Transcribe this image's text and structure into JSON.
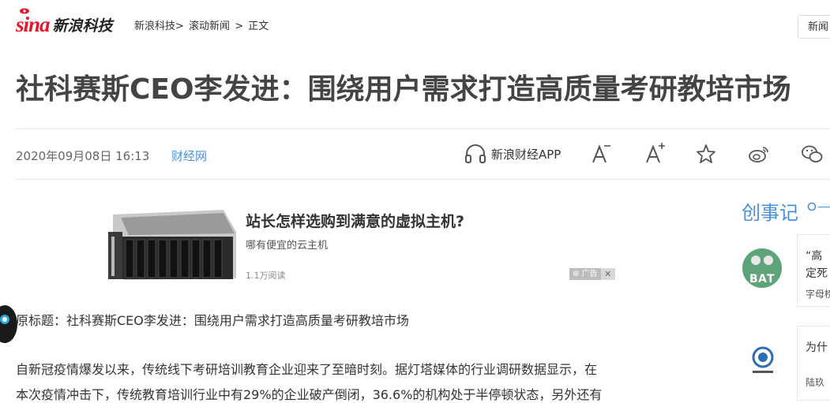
{
  "header": {
    "logo_sina": "sina",
    "logo_tech": "新浪科技",
    "breadcrumb": [
      "新浪科技>",
      "滚动新闻",
      ">",
      "正文"
    ],
    "news_button": "新闻"
  },
  "article": {
    "title": "社科赛斯CEO李发进：围绕用户需求打造高质量考研教培市场",
    "date": "2020年09月08日 16:13",
    "source": "财经网",
    "app_label": "新浪财经APP",
    "tools": [
      "font-smaller-icon",
      "font-larger-icon",
      "favorite-star-icon",
      "weibo-icon",
      "wechat-icon"
    ],
    "original_title": "原标题：社科赛斯CEO李发进：围绕用户需求打造高质量考研教培市场",
    "paragraph1": "自新冠疫情爆发以来，传统线下考研培训教育企业迎来了至暗时刻。据灯塔媒体的行业调研数据显示，在",
    "paragraph2": "本次疫情冲击下，传统教育培训行业中有29%的企业破产倒闭，36.6%的机构处于半停顿状态，另外还有"
  },
  "ad": {
    "title": "站长怎样选购到满意的虚拟主机?",
    "subtitle": "哪有便宜的云主机",
    "reads": "1.1万阅读",
    "tag": "广告",
    "close": "✕"
  },
  "sidebar": {
    "title": "创事记",
    "cards": [
      {
        "line1": "“高",
        "line2": "定死",
        "meta": "字母榜"
      },
      {
        "line1": "为什",
        "line2": "",
        "meta": "陆玖"
      }
    ]
  },
  "colors": {
    "accent_blue": "#4a90d9",
    "sina_red": "#e6162d",
    "title_gray": "#444444"
  }
}
